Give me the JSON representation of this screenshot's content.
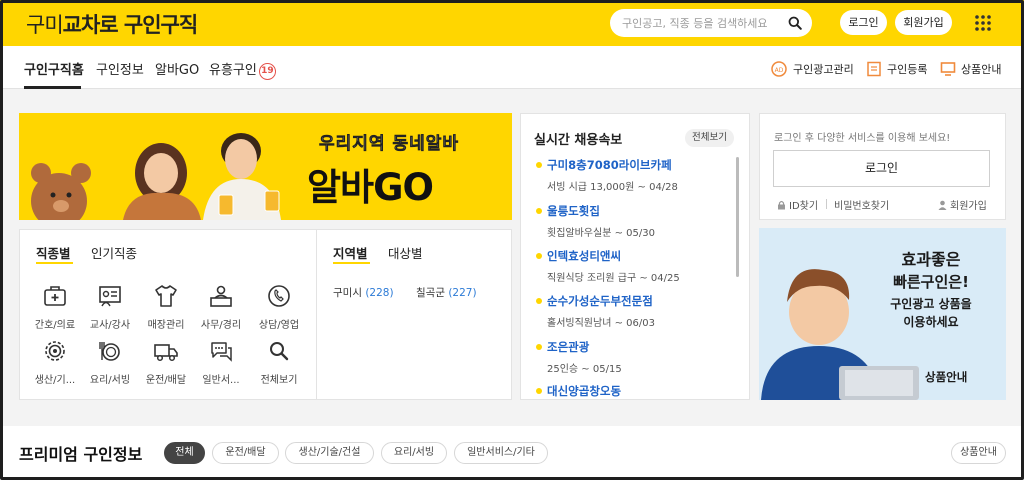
{
  "header": {
    "logo_light": "구미",
    "logo_bold": "교차로",
    "logo_suffix": "구인구직",
    "search_placeholder": "구인공고, 직종 등을 검색하세요",
    "login_label": "로그인",
    "signup_label": "회원가입"
  },
  "nav": {
    "tabs": [
      "구인구직홈",
      "구인정보",
      "알바GO",
      "유흥구인"
    ],
    "badge": "19",
    "right_links": [
      "구인광고관리",
      "구인등록",
      "상품안내"
    ]
  },
  "banner": {
    "line1": "우리지역 동네알바",
    "line2": "알바GO"
  },
  "categories": {
    "tabs": [
      "직종별",
      "인기직종"
    ],
    "items": [
      {
        "label": "간호/의료",
        "icon": "medical-kit-icon"
      },
      {
        "label": "교사/강사",
        "icon": "teacher-board-icon"
      },
      {
        "label": "매장관리",
        "icon": "shirt-icon"
      },
      {
        "label": "사무/경리",
        "icon": "office-worker-icon"
      },
      {
        "label": "상담/영업",
        "icon": "phone-icon"
      },
      {
        "label": "생산/기...",
        "icon": "gear-icon"
      },
      {
        "label": "요리/서빙",
        "icon": "dish-icon"
      },
      {
        "label": "운전/배달",
        "icon": "truck-icon"
      },
      {
        "label": "일반서...",
        "icon": "chat-bubble-icon"
      },
      {
        "label": "전체보기",
        "icon": "search-icon"
      }
    ]
  },
  "regions": {
    "tabs": [
      "지역별",
      "대상별"
    ],
    "items": [
      {
        "name": "구미시",
        "count": "(228)"
      },
      {
        "name": "칠곡군",
        "count": "(227)"
      }
    ]
  },
  "realtime": {
    "title": "실시간 채용속보",
    "all_label": "전체보기",
    "items": [
      {
        "name": "구미8층7080라이브카페",
        "sub": "서빙 시급 13,000원 ~ 04/28"
      },
      {
        "name": "울릉도횟집",
        "sub": "횟집알바우실분 ~ 05/30"
      },
      {
        "name": "인텍효성티앤씨",
        "sub": "직원식당 조리원 급구 ~ 04/25"
      },
      {
        "name": "순수가성순두부전문점",
        "sub": "홀서빙직원남녀 ~ 06/03"
      },
      {
        "name": "조은관광",
        "sub": "25인승 ~ 05/15"
      },
      {
        "name": "대신양곱창오동",
        "sub": ""
      }
    ]
  },
  "login_box": {
    "info": "로그인 후 다양한 서비스를 이용해 보세요!",
    "button": "로그인",
    "find_id": "ID찾기",
    "find_pw": "비밀번호찾기",
    "signup": "회원가입"
  },
  "ad": {
    "line1": "효과좋은",
    "line2": "빠른구인은!",
    "line3": "구인광고 상품을",
    "line4": "이용하세요",
    "link": "상품안내"
  },
  "premium": {
    "title": "프리미엄 구인정보",
    "chips": [
      "전체",
      "운전/배달",
      "생산/기술/건설",
      "요리/서빙",
      "일반서비스/기타"
    ],
    "product_label": "상품안내"
  },
  "colors": {
    "brand_yellow": "#ffd600",
    "link_blue": "#1f63c7",
    "badge_red": "#e4514a"
  }
}
